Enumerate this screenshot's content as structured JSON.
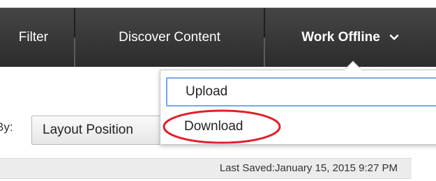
{
  "nav": {
    "items": [
      {
        "label": "Filter"
      },
      {
        "label": "Discover Content"
      },
      {
        "label": "Work Offline"
      }
    ]
  },
  "dropdown": {
    "items": [
      {
        "label": "Upload"
      },
      {
        "label": "Download"
      }
    ],
    "highlight_color": "#e0202a"
  },
  "sort": {
    "label": "By:",
    "selected": "Layout Position"
  },
  "status": {
    "last_saved": "Last Saved:January 15, 2015 9:27 PM"
  },
  "colors": {
    "nav_bg": "#3a3a3a",
    "nav_text": "#ffffff",
    "menu_focus_border": "#7aa6e6",
    "annotation": "#e0202a"
  }
}
